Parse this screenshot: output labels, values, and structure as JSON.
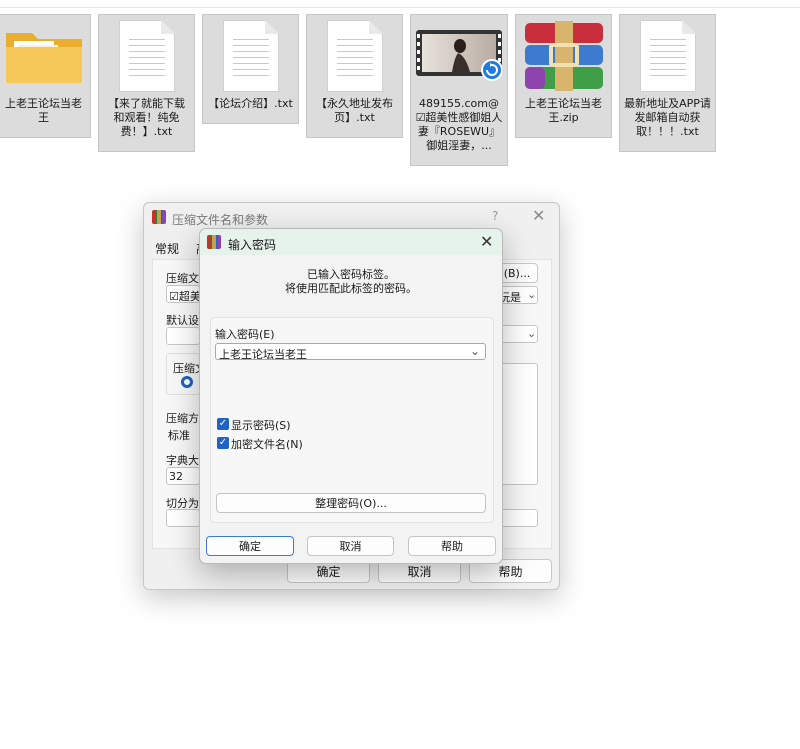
{
  "files": [
    {
      "name": "上老王论坛当老王",
      "icon": "folder-icon"
    },
    {
      "name": "【来了就能下载和观看！纯免费！】.txt",
      "icon": "text-file-icon"
    },
    {
      "name": "【论坛介绍】.txt",
      "icon": "text-file-icon"
    },
    {
      "name": "【永久地址发布页】.txt",
      "icon": "text-file-icon"
    },
    {
      "name": "489155.com@☑超美性感御姐人妻『ROSEWU』御姐淫妻，...",
      "icon": "video-file-icon"
    },
    {
      "name": "上老王论坛当老王.zip",
      "icon": "winrar-archive-icon"
    },
    {
      "name": "最新地址及APP请发邮箱自动获取！！！.txt",
      "icon": "text-file-icon"
    }
  ],
  "back_dialog": {
    "title": "压缩文件名和参数",
    "help_glyph": "?",
    "tabs": [
      "常规",
      "高"
    ],
    "archive_name_label": "压缩文件",
    "archive_name_value": "☑超美",
    "browse_label": "(B)...",
    "profile_value": "玩是",
    "default_settings_label": "默认设置",
    "archive_format_label": "压缩文",
    "compression_method_label": "压缩方式",
    "compression_method_value": "标准",
    "dictionary_label": "字典大小",
    "dictionary_value": "32",
    "split_label": "切分为分卷",
    "ok": "确定",
    "cancel": "取消",
    "help": "帮助"
  },
  "password_dialog": {
    "title": "输入密码",
    "info_line1": "已输入密码标签。",
    "info_line2": "将使用匹配此标签的密码。",
    "password_label": "输入密码(E)",
    "password_value": "上老王论坛当老王",
    "show_password": "显示密码(S)",
    "encrypt_filenames": "加密文件名(N)",
    "organize_button": "整理密码(O)...",
    "ok": "确定",
    "cancel": "取消",
    "help": "帮助"
  },
  "colors": {
    "accent": "#1e63c5",
    "folder": "#f6c85a",
    "titlebar": "#e6f2ec"
  }
}
